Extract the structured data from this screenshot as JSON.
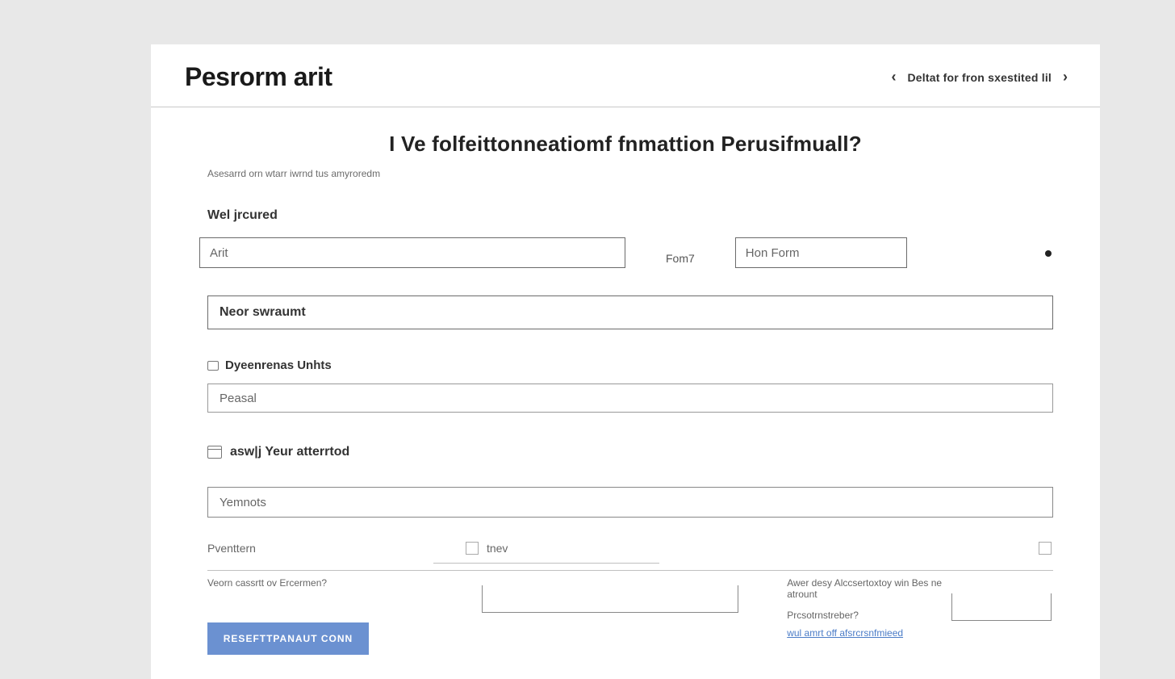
{
  "header": {
    "title": "Pesrorm arit",
    "pager_label": "Deltat for fron sxestited lil"
  },
  "page": {
    "heading": "I Ve folfeittonneatiomf fnmattion Perusifmuall?",
    "subtext": "Asesarrd orn wtarr iwrnd tus amyroredm"
  },
  "row1": {
    "label_main": "Wel jrcured",
    "input1_value": "Arit",
    "label2": "Fom7",
    "input2_value": "Hon Form"
  },
  "field_neor": {
    "value": "Neor swraumt"
  },
  "field_users": {
    "label": "Dyeenrenas Unhts",
    "value": "Peasal"
  },
  "field_year": {
    "label": "asw|j Yeur atterrtod"
  },
  "field_yemnots": {
    "value": "Yemnots"
  },
  "checks": {
    "left_label": "Pventtern",
    "mid_label": "tnev"
  },
  "bottom": {
    "left_question": "Veorn cassrtt ov Ercermen?",
    "button_label": "RESEFTTPANAUT CONN",
    "right_question1": "Awer desy Alccsertoxtoy win Bes ne atrount",
    "right_question2": "Prcsotrnstreber?",
    "right_link": "wul amrt off afsrcrsnfmieed"
  }
}
